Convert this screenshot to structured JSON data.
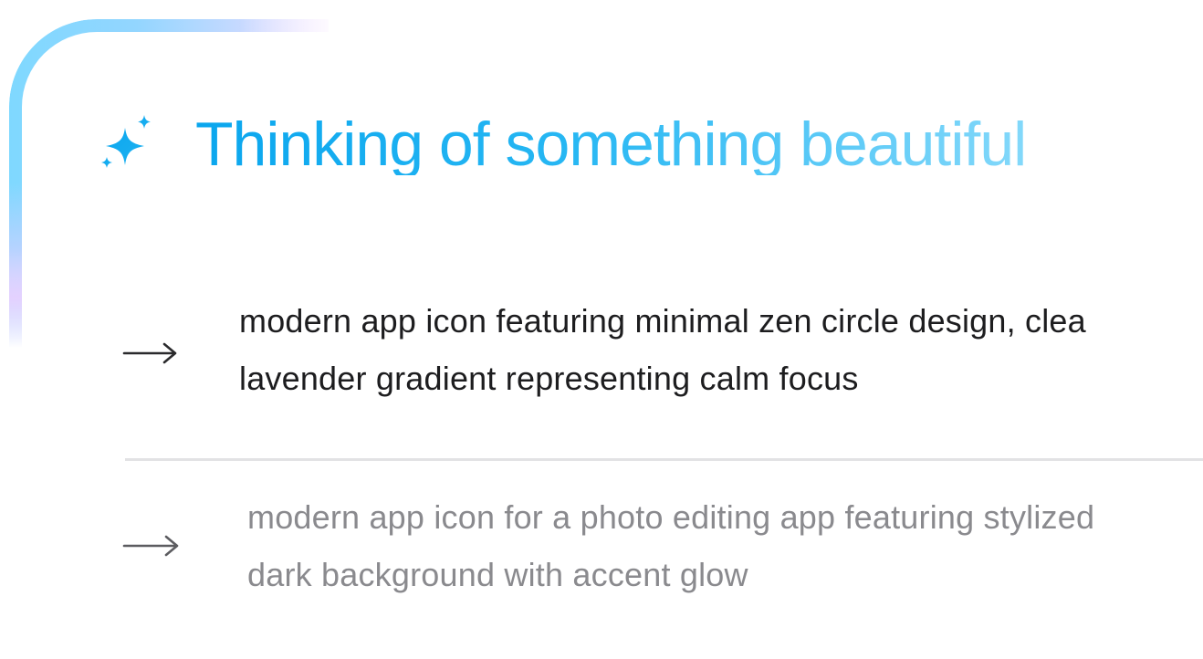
{
  "header": {
    "icon": "sparkles-icon",
    "title": "Thinking of something beautiful",
    "title_gradient": [
      "#0aa6ee",
      "#83d8fa"
    ]
  },
  "frame": {
    "gradient": [
      "#7fd8ff",
      "#f2dcff"
    ]
  },
  "suggestions": [
    {
      "icon": "arrow-right-icon",
      "line1": "modern app icon featuring minimal zen circle design, clea",
      "line2": "lavender gradient representing calm focus",
      "color": "#1d1d1f"
    },
    {
      "icon": "arrow-right-icon",
      "line1": "modern app icon for a photo editing app featuring stylized",
      "line2": "dark background with accent glow",
      "color": "#8a8a8e"
    }
  ]
}
